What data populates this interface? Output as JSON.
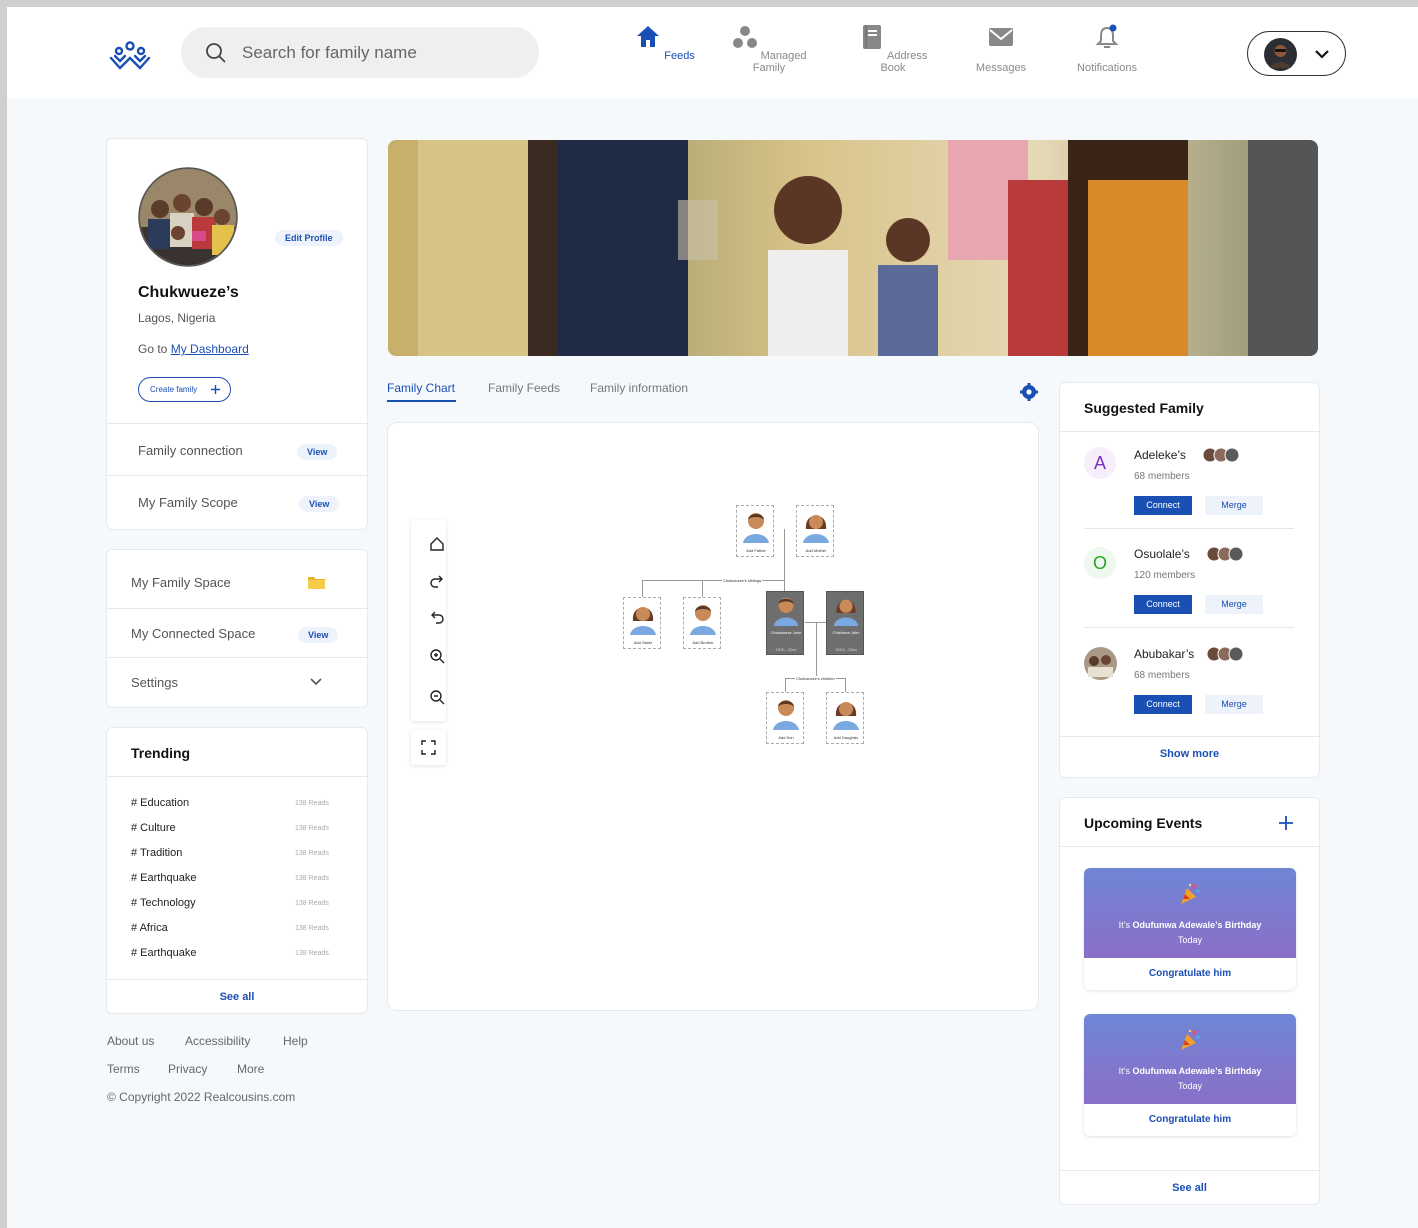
{
  "search": {
    "placeholder": "Search for family name"
  },
  "nav": [
    {
      "label": "Feeds",
      "icon": "home-icon",
      "active": true
    },
    {
      "label": "Managed Family",
      "icon": "family-icon",
      "active": false
    },
    {
      "label": "Address Book",
      "icon": "book-icon",
      "active": false
    },
    {
      "label": "Messages",
      "icon": "mail-icon",
      "active": false
    },
    {
      "label": "Notifications",
      "icon": "bell-icon",
      "active": false
    }
  ],
  "profile": {
    "name": "Chukwueze’s",
    "location": "Lagos, Nigeria",
    "goto_prefix": "Go to",
    "goto_link": "My Dashboard",
    "edit": "Edit Profile",
    "create": "Create family",
    "family_connection": "Family connection",
    "family_scope": "My Family Scope",
    "view": "View"
  },
  "space": {
    "family_space": "My Family Space",
    "connected_space": "My Connected Space",
    "settings": "Settings",
    "view": "View"
  },
  "trending": {
    "title": "Trending",
    "items": [
      {
        "tag": "# Education",
        "reads": "138 Reads"
      },
      {
        "tag": "# Culture",
        "reads": "138 Reads"
      },
      {
        "tag": "# Tradition",
        "reads": "138 Reads"
      },
      {
        "tag": "# Earthquake",
        "reads": "138 Reads"
      },
      {
        "tag": "# Technology",
        "reads": "138 Reads"
      },
      {
        "tag": "# Africa",
        "reads": "138 Reads"
      },
      {
        "tag": "# Earthquake",
        "reads": "138 Reads"
      }
    ],
    "see_all": "See all"
  },
  "footer": {
    "about": "About us",
    "accessibility": "Accessibility",
    "help": "Help",
    "terms": "Terms",
    "privacy": "Privacy",
    "more": "More",
    "copyright": "© Copyright 2022 Realcousins.com"
  },
  "tabs": [
    "Family Chart",
    "Family Feeds",
    "Family information"
  ],
  "tree": {
    "add_father": "Add Father",
    "add_mother": "Add Mother",
    "siblings": "Chukwueze's siblings",
    "add_sister": "Add Sister",
    "add_brother": "Add Brother",
    "self_name": "Chukwueze John",
    "self_sub": "1970 - 20xx",
    "spouse_name": "Chiefoma John",
    "spouse_sub": "19XX - 20xx",
    "children": "Chukwueze's children",
    "add_son": "Add Son",
    "add_daughter": "Add Daughter"
  },
  "suggested": {
    "title": "Suggested Family",
    "items": [
      {
        "letter": "A",
        "name": "Adeleke’s",
        "members": "68 members",
        "color": "#7b2fbf",
        "bg": "#f6eefb"
      },
      {
        "letter": "O",
        "name": "Osuolale’s",
        "members": "120 members",
        "color": "#2aa52a",
        "bg": "#eef8ee"
      },
      {
        "letter": "",
        "name": "Abubakar’s",
        "members": "68 members",
        "color": "#000",
        "bg": "#ddd"
      }
    ],
    "connect": "Connect",
    "merge": "Merge",
    "show_more": "Show more"
  },
  "events": {
    "title": "Upcoming Events",
    "items": [
      {
        "prefix": "It’s",
        "who": "Odufunwa Adewale’s Birthday",
        "when": "Today",
        "cta": "Congratulate him"
      },
      {
        "prefix": "It’s",
        "who": "Odufunwa Adewale’s Birthday",
        "when": "Today",
        "cta": "Congratulate him"
      }
    ],
    "see_all": "See all"
  },
  "colors": {
    "accent": "#1a4fb4",
    "background": "#f6f9fc"
  }
}
